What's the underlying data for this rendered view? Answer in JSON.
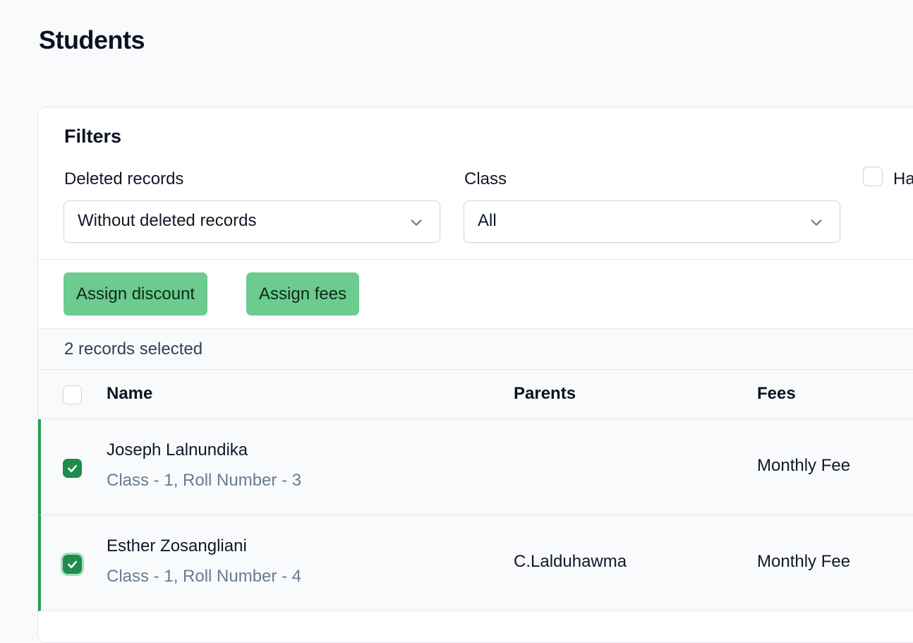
{
  "page": {
    "title": "Students"
  },
  "filters": {
    "title": "Filters",
    "deleted": {
      "label": "Deleted records",
      "value": "Without deleted records"
    },
    "class": {
      "label": "Class",
      "value": "All"
    },
    "checkbox_label": "Ha"
  },
  "actions": {
    "assign_discount": "Assign discount",
    "assign_fees": "Assign fees"
  },
  "selection": {
    "text": "2 records selected"
  },
  "table": {
    "columns": {
      "name": "Name",
      "parents": "Parents",
      "fees": "Fees"
    },
    "rows": [
      {
        "name": "Joseph Lalnundika",
        "sub": "Class - 1, Roll Number - 3",
        "parents": "",
        "fees": "Monthly Fee",
        "selected": true
      },
      {
        "name": "Esther Zosangliani",
        "sub": "Class - 1, Roll Number - 4",
        "parents": "C.Lalduhawma",
        "fees": "Monthly Fee",
        "selected": true
      }
    ]
  },
  "colors": {
    "accent": "#1f8b4c",
    "button": "#6ccb8f",
    "row_indicator": "#22a04f"
  }
}
